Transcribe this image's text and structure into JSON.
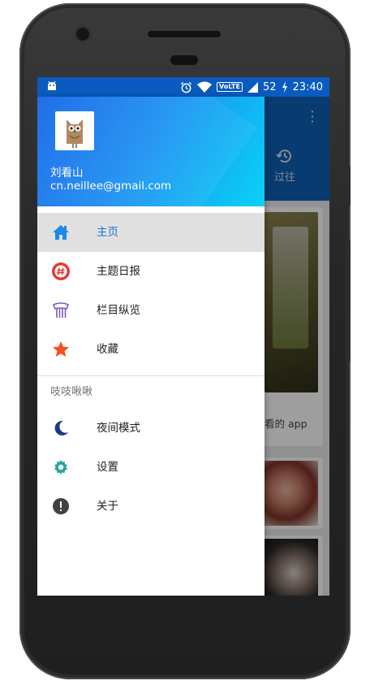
{
  "status_bar": {
    "left_icon": "android-notification-icon",
    "battery": "52",
    "time": "23:40",
    "network_badge": "VoLTE",
    "icons": [
      "alarm-icon",
      "wifi-icon",
      "signal-icon",
      "battery-charging-icon"
    ]
  },
  "background_app": {
    "tab_label": "过往",
    "card_text": "看的 app"
  },
  "drawer": {
    "user_name": "刘看山",
    "email": "cn.neillee@gmail.com",
    "items": [
      {
        "label": "主页",
        "icon": "home-icon",
        "active": true
      },
      {
        "label": "主题日报",
        "icon": "hashtag-icon",
        "active": false
      },
      {
        "label": "栏目纵览",
        "icon": "columns-icon",
        "active": false
      },
      {
        "label": "收藏",
        "icon": "star-icon",
        "active": false
      }
    ],
    "section_title": "吱吱啾啾",
    "settings_items": [
      {
        "label": "夜间模式",
        "icon": "moon-icon"
      },
      {
        "label": "设置",
        "icon": "gear-icon"
      },
      {
        "label": "关于",
        "icon": "info-icon"
      }
    ]
  },
  "colors": {
    "status_bar": "#0a5bbf",
    "header_start": "#1466e6",
    "header_end": "#0ad2f6",
    "active_label": "#1976d2",
    "home_icon": "#1e88e5",
    "hashtag_icon": "#e53935",
    "columns_icon": "#7e57c2",
    "star_icon": "#f4511e",
    "moon_icon": "#1e3a8a",
    "gear_icon": "#26a69a",
    "info_icon": "#424242"
  }
}
